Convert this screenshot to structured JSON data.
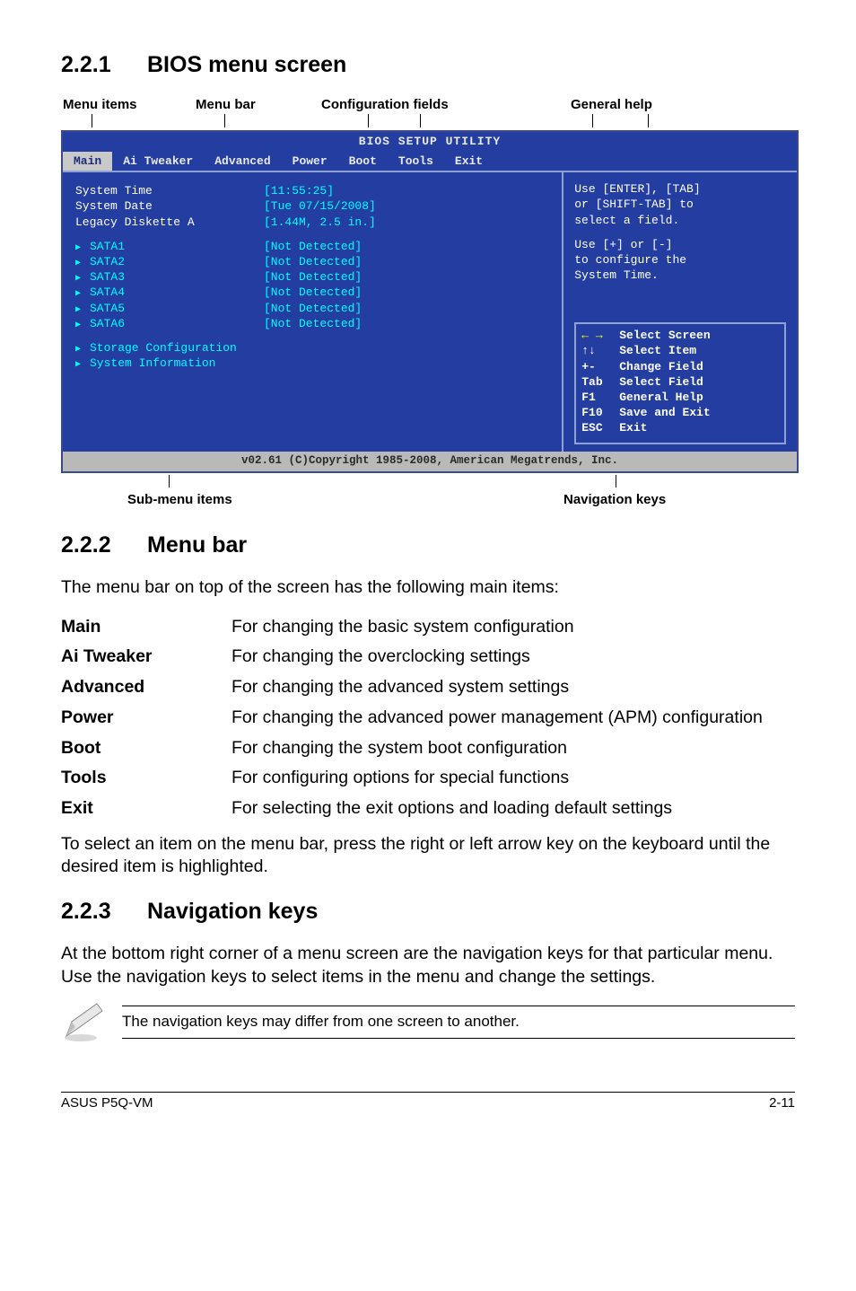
{
  "sections": {
    "s1": {
      "num": "2.2.1",
      "title": "BIOS menu screen"
    },
    "s2": {
      "num": "2.2.2",
      "title": "Menu bar"
    },
    "s3": {
      "num": "2.2.3",
      "title": "Navigation keys"
    }
  },
  "diagram_labels": {
    "menu_items": "Menu items",
    "menu_bar": "Menu bar",
    "config_fields": "Configuration fields",
    "general_help": "General help",
    "sub_menu": "Sub-menu items",
    "nav_keys": "Navigation keys"
  },
  "bios": {
    "title": "BIOS SETUP UTILITY",
    "tabs": [
      "Main",
      "Ai Tweaker",
      "Advanced",
      "Power",
      "Boot",
      "Tools",
      "Exit"
    ],
    "rows": {
      "system_time": {
        "label": "System Time",
        "value": "[11:55:25]"
      },
      "system_date": {
        "label": "System Date",
        "value": "[Tue 07/15/2008]"
      },
      "legacy": {
        "label": "Legacy Diskette A",
        "value": "[1.44M, 2.5 in.]"
      }
    },
    "sata": [
      "SATA1",
      "SATA2",
      "SATA3",
      "SATA4",
      "SATA5",
      "SATA6"
    ],
    "sata_value": "[Not Detected]",
    "extra": [
      "Storage Configuration",
      "System Information"
    ],
    "help": {
      "l1": "Use [ENTER], [TAB]",
      "l2": "or [SHIFT-TAB] to",
      "l3": "select a field.",
      "l4": "Use [+] or [-]",
      "l5": "to configure the",
      "l6": "System Time."
    },
    "keys": [
      {
        "k": "← →",
        "d": "Select Screen",
        "arrow": true
      },
      {
        "k": "↑↓",
        "d": "Select Item"
      },
      {
        "k": "+-",
        "d": "Change Field"
      },
      {
        "k": "Tab",
        "d": "Select Field"
      },
      {
        "k": "F1",
        "d": "General Help"
      },
      {
        "k": "F10",
        "d": "Save and Exit"
      },
      {
        "k": "ESC",
        "d": "Exit"
      }
    ],
    "footer": "v02.61 (C)Copyright 1985-2008, American Megatrends, Inc."
  },
  "menu_intro": "The menu bar on top of the screen has the following main items:",
  "defs": [
    {
      "term": "Main",
      "desc": "For changing the basic system configuration"
    },
    {
      "term": "Ai Tweaker",
      "desc": "For changing the overclocking settings"
    },
    {
      "term": "Advanced",
      "desc": "For changing the advanced system settings"
    },
    {
      "term": "Power",
      "desc": "For changing the advanced power management (APM) configuration"
    },
    {
      "term": "Boot",
      "desc": "For changing the system boot configuration"
    },
    {
      "term": "Tools",
      "desc": "For configuring options for special functions"
    },
    {
      "term": "Exit",
      "desc": "For selecting the exit options and loading default settings"
    }
  ],
  "menu_outro": "To select an item on the menu bar, press the right or left arrow key on the keyboard until the desired item is highlighted.",
  "nav_body": "At the bottom right corner of a menu screen are the navigation keys for that particular menu. Use the navigation keys to select items in the menu and change the settings.",
  "note_msg": "The navigation keys may differ from one screen to another.",
  "page_footer": {
    "left": "ASUS P5Q-VM",
    "right": "2-11"
  }
}
